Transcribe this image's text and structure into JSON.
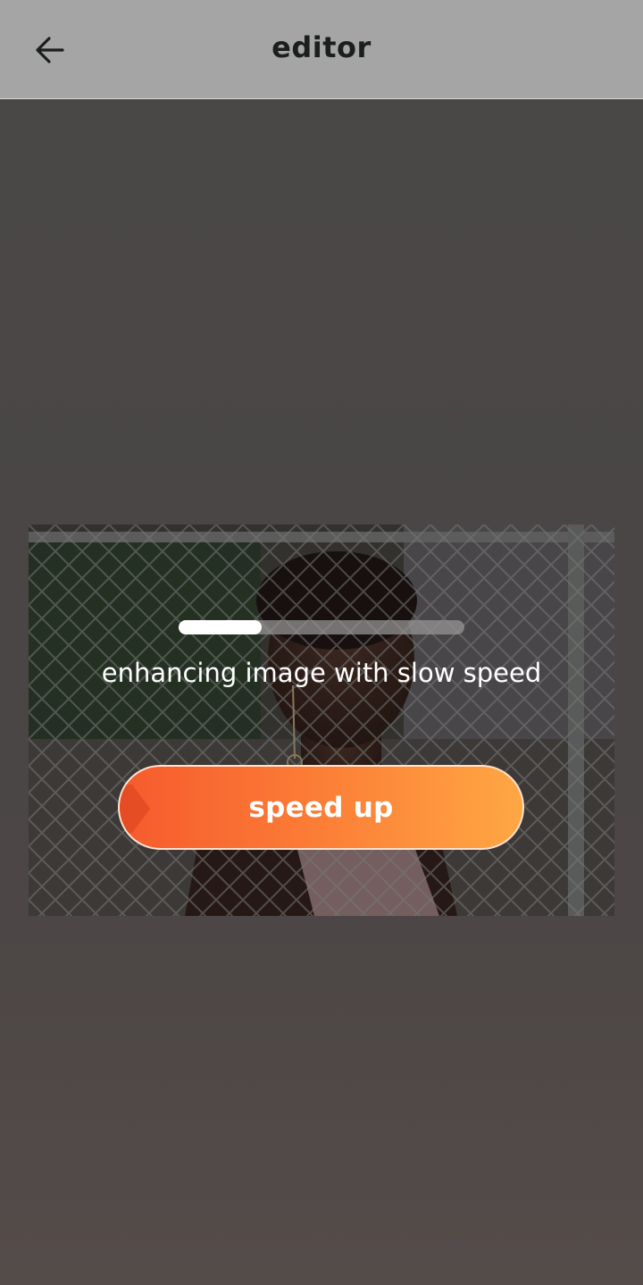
{
  "header": {
    "title": "editor",
    "back_icon": "arrow-left-icon"
  },
  "progress": {
    "fraction": 0.29
  },
  "status": {
    "message": "enhancing image with slow speed"
  },
  "action": {
    "speed_up_label": "speed up",
    "colors": {
      "start": "#f65a2e",
      "end": "#ffa744"
    }
  }
}
